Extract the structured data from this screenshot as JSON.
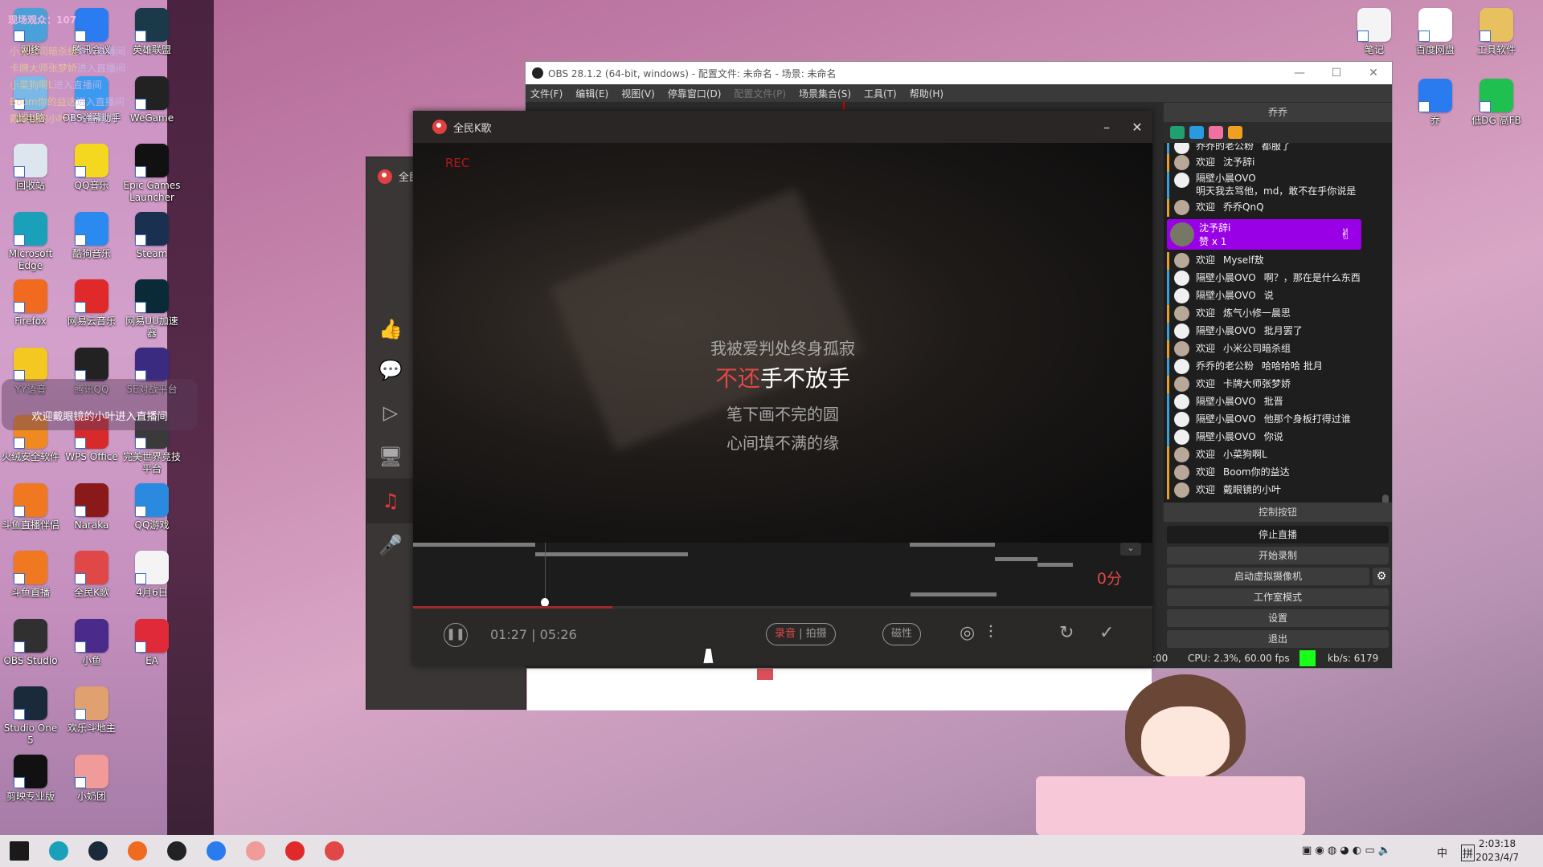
{
  "overlay": {
    "viewers": "现场观众：107",
    "entries": [
      {
        "user": "小米公司暗杀组",
        "suffix": "进入直播间"
      },
      {
        "user": "卡牌大师张梦娇",
        "suffix": "进入直播间"
      },
      {
        "user": "小菜狗啊L",
        "suffix": "进入直播间"
      },
      {
        "user": "Boom你的益达",
        "suffix": "进入直播间"
      },
      {
        "user": "戴眼镜的小叶",
        "suffix": "进入直播间"
      }
    ],
    "banner": "欢迎戴眼镜的小叶进入直播间"
  },
  "desktop": {
    "left_icons": [
      [
        "网络",
        "#4aa0d8"
      ],
      [
        "腾讯会议",
        "#2a7cf0"
      ],
      [
        "英雄联盟",
        "#1a3a4a"
      ],
      [
        "此电脑",
        "#7ab8e8"
      ],
      [
        "OBS弹幕助手",
        "#3a9af0"
      ],
      [
        "WeGame",
        "#222222"
      ],
      [
        "回收站",
        "#dde6ee"
      ],
      [
        "QQ音乐",
        "#f4d820"
      ],
      [
        "Epic Games Launcher",
        "#111111"
      ],
      [
        "Microsoft Edge",
        "#1aa0b8"
      ],
      [
        "酷狗音乐",
        "#2a8af0"
      ],
      [
        "Steam",
        "#1a3050"
      ],
      [
        "Firefox",
        "#f06a20"
      ],
      [
        "网易云音乐",
        "#e02a2a"
      ],
      [
        "网易UU加速器",
        "#0a2a38"
      ],
      [
        "YY语音",
        "#f4c820"
      ],
      [
        "腾讯QQ",
        "#222222"
      ],
      [
        "5E对战平台",
        "#3a2a80"
      ],
      [
        "火绒安全软件",
        "#f08a20"
      ],
      [
        "WPS Office",
        "#d82a2a"
      ],
      [
        "完美世界竞技平台",
        "#3a3a3a"
      ],
      [
        "斗鱼直播伴侣",
        "#f07820"
      ],
      [
        "Naraka",
        "#8a1a1a"
      ],
      [
        "QQ游戏",
        "#2a8ae0"
      ],
      [
        "斗鱼直播",
        "#f07820"
      ],
      [
        "全民K歌",
        "#e04848"
      ],
      [
        "4月6日",
        "#f4f4f4"
      ],
      [
        "OBS Studio",
        "#303030"
      ],
      [
        "小鱼",
        "#4a2a8a"
      ],
      [
        "EA",
        "#e02a3a"
      ],
      [
        "Studio One 5",
        "#1a2a3a"
      ],
      [
        "欢乐斗地主",
        "#e0a070"
      ],
      [
        "",
        ""
      ],
      [
        "剪映专业版",
        "#111111"
      ],
      [
        "小奶团",
        "#f09a9a"
      ]
    ],
    "right_icons": [
      [
        "笔记",
        "#f4f4f4"
      ],
      [
        "百度网盘",
        "#ffffff"
      ],
      [
        "工具软件",
        "#e8c060"
      ],
      [
        "乔",
        "#2a7af0"
      ],
      [
        "低DG 高FB",
        "#20c050"
      ]
    ]
  },
  "obs": {
    "title": "OBS 28.1.2 (64-bit, windows) - 配置文件: 未命名 - 场景: 未命名",
    "window_controls": [
      "—",
      "☐",
      "✕"
    ],
    "menu": [
      {
        "label": "文件(F)",
        "enabled": true
      },
      {
        "label": "编辑(E)",
        "enabled": true
      },
      {
        "label": "视图(V)",
        "enabled": true
      },
      {
        "label": "停靠窗口(D)",
        "enabled": true
      },
      {
        "label": "配置文件(P)",
        "enabled": false
      },
      {
        "label": "场景集合(S)",
        "enabled": true
      },
      {
        "label": "工具(T)",
        "enabled": true
      },
      {
        "label": "帮助(H)",
        "enabled": true
      }
    ],
    "chat": {
      "title": "乔乔",
      "tool_icons": [
        [
          "home-icon",
          "#20a070"
        ],
        [
          "chat-icon",
          "#2a9ae0"
        ],
        [
          "gift-icon",
          "#f070a0"
        ],
        [
          "megaphone-icon",
          "#f0a020"
        ]
      ],
      "rows_before": [
        {
          "type": "msg",
          "user": "乔乔的老公粉",
          "text": "都服了"
        },
        {
          "type": "welcome",
          "user": "欢迎",
          "text": "沈予辞i"
        },
        {
          "type": "msg",
          "user": "隔壁小晨OVO",
          "text": "",
          "line2": "明天我去骂他，md，敢不在乎你说是"
        },
        {
          "type": "welcome",
          "user": "欢迎",
          "text": "乔乔QnQ"
        }
      ],
      "gift": {
        "user": "沈予辞i",
        "detail": "赞 x 1"
      },
      "rows_after": [
        {
          "type": "welcome",
          "user": "欢迎",
          "text": "Myself敖"
        },
        {
          "type": "msg",
          "user": "隔壁小晨OVO",
          "text": "啊？，那在是什么东西"
        },
        {
          "type": "msg",
          "user": "隔壁小晨OVO",
          "text": "说"
        },
        {
          "type": "welcome",
          "user": "欢迎",
          "text": "炼气小修一晨思"
        },
        {
          "type": "msg",
          "user": "隔壁小晨OVO",
          "text": "批月罢了"
        },
        {
          "type": "welcome",
          "user": "欢迎",
          "text": "小米公司暗杀组"
        },
        {
          "type": "msg",
          "user": "乔乔的老公粉",
          "text": "哈哈哈哈 批月"
        },
        {
          "type": "welcome",
          "user": "欢迎",
          "text": "卡牌大师张梦娇"
        },
        {
          "type": "msg",
          "user": "隔壁小晨OVO",
          "text": "批晋"
        },
        {
          "type": "msg",
          "user": "隔壁小晨OVO",
          "text": "他那个身板打得过谁"
        },
        {
          "type": "msg",
          "user": "隔壁小晨OVO",
          "text": "你说"
        },
        {
          "type": "welcome",
          "user": "欢迎",
          "text": "小菜狗啊L"
        },
        {
          "type": "welcome",
          "user": "欢迎",
          "text": "Boom你的益达"
        },
        {
          "type": "welcome",
          "user": "欢迎",
          "text": "戴眼镜的小叶"
        }
      ]
    },
    "controls": {
      "title": "控制按钮",
      "stop_stream": "停止直播",
      "start_record": "开始录制",
      "virtual_cam": "启动虚拟摄像机",
      "studio_mode": "工作室模式",
      "settings": "设置",
      "exit": "退出"
    },
    "status": {
      "time_fragment": ":00",
      "cpu": "CPU: 2.3%, 60.00 fps",
      "kbps": "kb/s: 6179",
      "health_color": "#1aff1a"
    }
  },
  "karaoke": {
    "app_name": "全民K歌",
    "back_title": "全民",
    "rec": "REC",
    "lyrics": {
      "prev": "我被爱判处终身孤寂",
      "current_sung": "不还",
      "current_rest": "手不放手",
      "next1": "笔下画不完的圆",
      "next2": "心间填不满的缘"
    },
    "score": "0分",
    "elapsed": "01:27",
    "duration": "05:26",
    "progress_fraction": 0.27,
    "mode_record": "录音",
    "mode_video": "拍摄",
    "effect": "磁性",
    "accent": "#e04848"
  },
  "taskbar": {
    "apps": [
      [
        "windows-start-icon",
        "#1a1a1a"
      ],
      [
        "edge-icon",
        "#1aa0b8"
      ],
      [
        "terminal-icon",
        "#1a2a3a"
      ],
      [
        "firefox-icon",
        "#f06a20"
      ],
      [
        "obs-icon",
        "#222222"
      ],
      [
        "app-icon",
        "#2a7af0"
      ],
      [
        "xiaonaituan-icon",
        "#f09a9a"
      ],
      [
        "netease-music-icon",
        "#e02a2a"
      ],
      [
        "quanmin-kge-icon",
        "#e04848"
      ]
    ],
    "ime_lang": "中",
    "ime_mode": "拼",
    "time": "2:03:18",
    "date": "2023/4/7"
  }
}
